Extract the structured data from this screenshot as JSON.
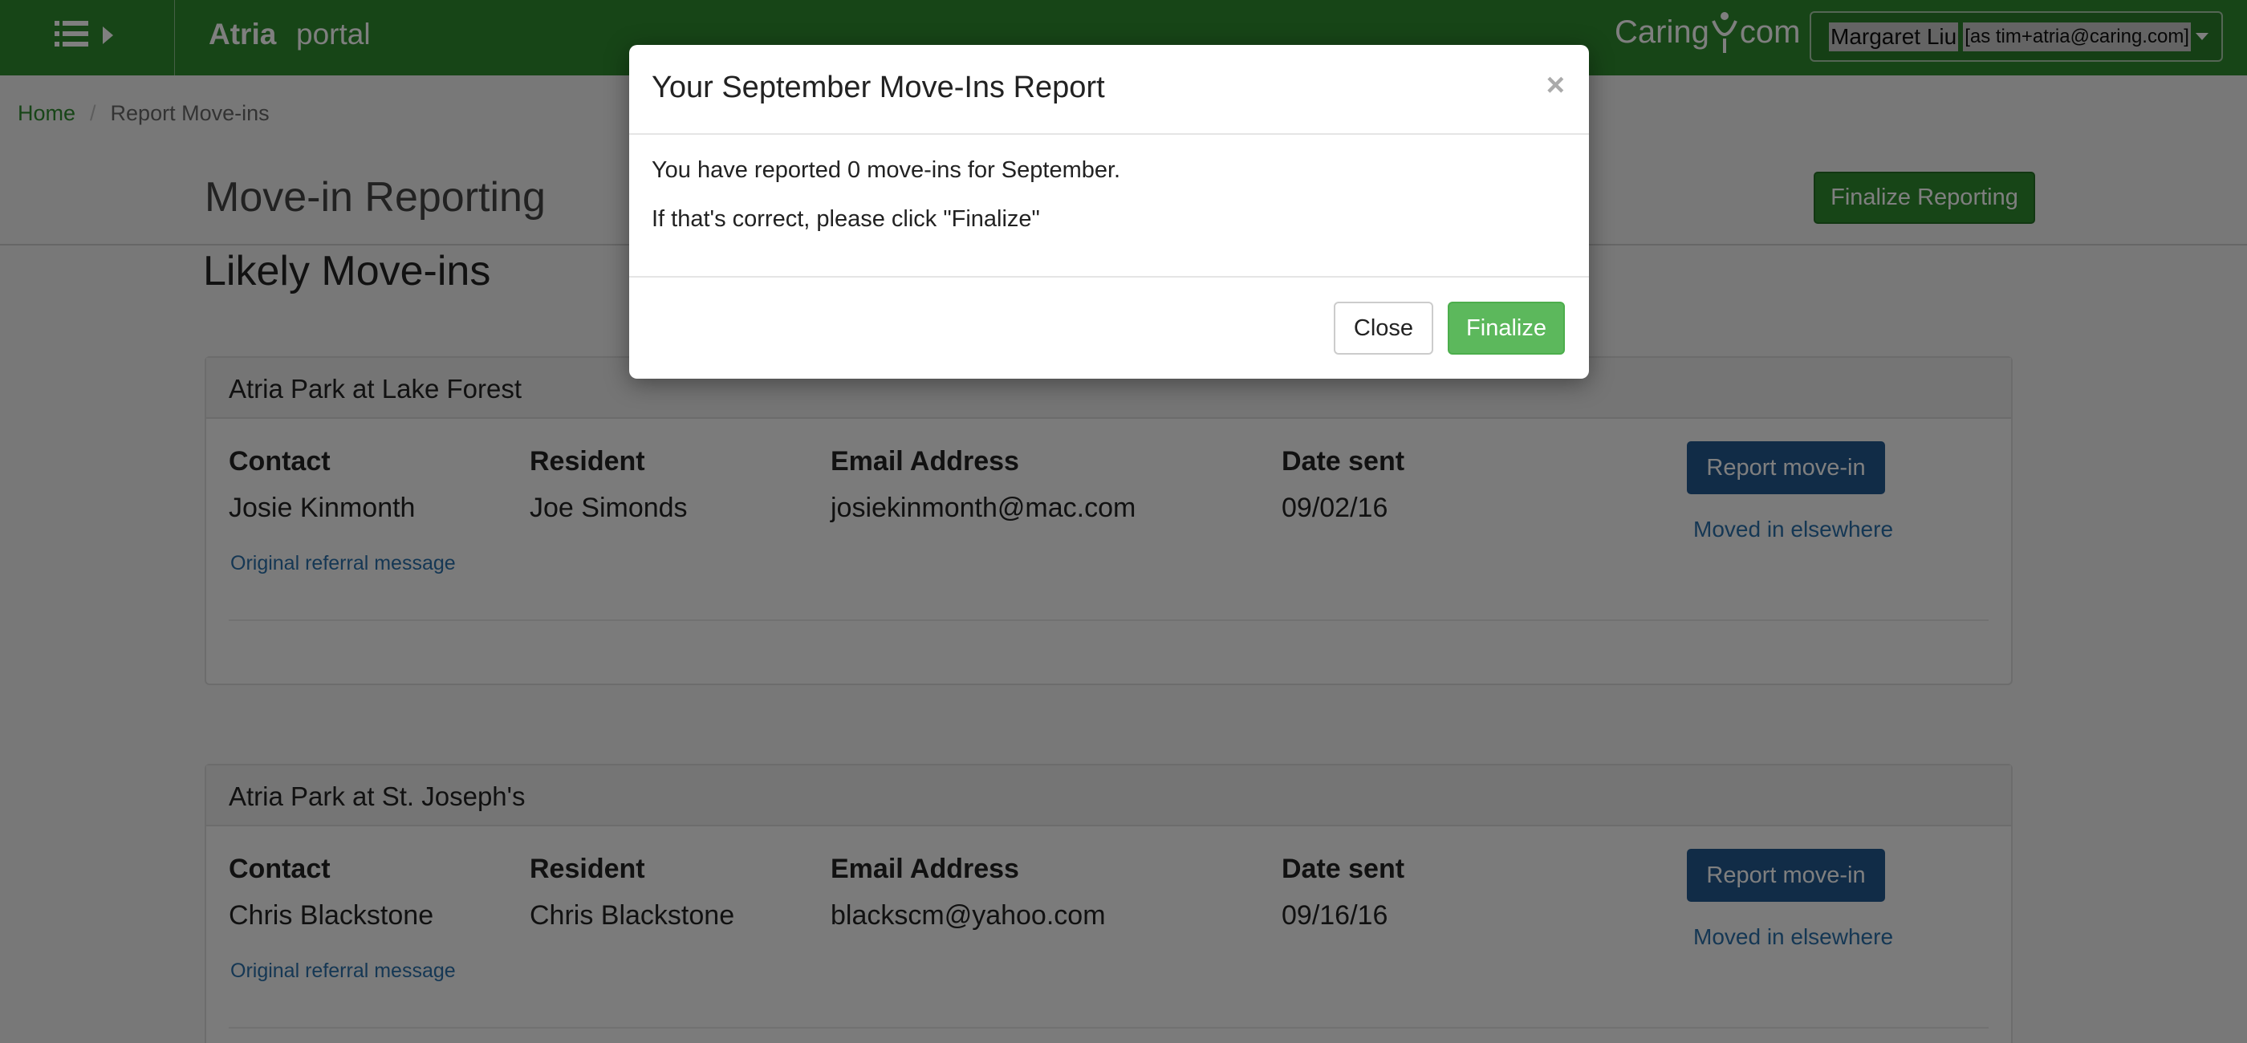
{
  "navbar": {
    "brand": "Atria",
    "brand_sub": "portal",
    "logo_text_left": "Caring",
    "logo_text_right": "com",
    "user_name": "Margaret Liu",
    "user_as": "[as tim+atria@caring.com]",
    "colors": {
      "nav_bg": "#2f8a2f"
    }
  },
  "breadcrumb": {
    "home": "Home",
    "separator": "/",
    "current": "Report Move-ins"
  },
  "header": {
    "title": "Move-in Reporting",
    "finalize_reporting": "Finalize Reporting"
  },
  "section_title": "Likely Move-ins",
  "columns": {
    "contact": "Contact",
    "resident": "Resident",
    "email": "Email Address",
    "date_sent": "Date sent"
  },
  "panels": [
    {
      "community": "Atria Park at Lake Forest",
      "contact": "Josie Kinmonth",
      "resident": "Joe Simonds",
      "email": "josiekinmonth@mac.com",
      "date_sent": "09/02/16",
      "referral_link": "Original referral message",
      "report_button": "Report move-in",
      "moved_elsewhere": "Moved in elsewhere"
    },
    {
      "community": "Atria Park at St. Joseph's",
      "contact": "Chris Blackstone",
      "resident": "Chris Blackstone",
      "email": "blackscm@yahoo.com",
      "date_sent": "09/16/16",
      "referral_link": "Original referral message",
      "report_button": "Report move-in",
      "moved_elsewhere": "Moved in elsewhere"
    }
  ],
  "modal": {
    "title": "Your September Move-Ins Report",
    "close_symbol": "×",
    "line1": "You have reported 0 move-ins for September.",
    "line2": "If that's correct, please click \"Finalize\"",
    "close_button": "Close",
    "finalize_button": "Finalize"
  }
}
